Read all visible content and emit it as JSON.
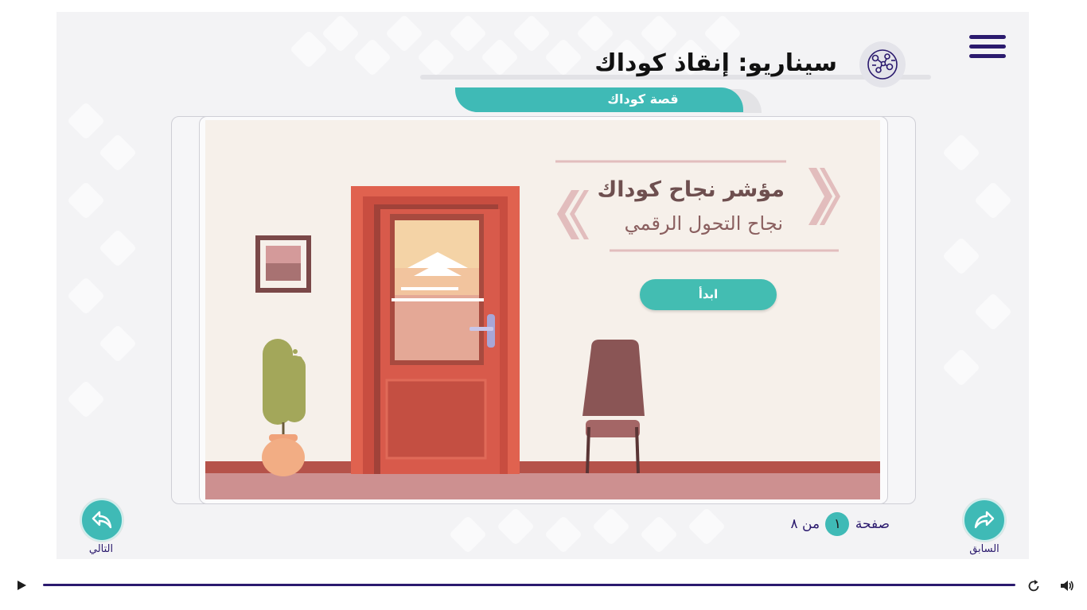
{
  "header": {
    "title": "سيناريو: إنقاذ كوداك",
    "tab_label": "قصة كوداك",
    "menu_icon": "hamburger-menu-icon",
    "scenario_icon": "circuit-network-icon"
  },
  "slide": {
    "heading": "مؤشر نجاح كوداك",
    "subheading": "نجاح التحول الرقمي",
    "start_button": "ابدأ"
  },
  "navigation": {
    "next_label": "التالي",
    "previous_label": "السابق",
    "page_word": "صفحة",
    "page_current": "١",
    "of_word": "من",
    "page_total": "٨"
  },
  "player": {
    "play_icon": "play-icon",
    "replay_icon": "replay-icon",
    "volume_icon": "volume-icon"
  },
  "colors": {
    "teal": "#3fbab6",
    "navy": "#2b1a6e",
    "wall": "#f6f0ea",
    "door": "#e0624f",
    "floor": "#cd9090"
  }
}
